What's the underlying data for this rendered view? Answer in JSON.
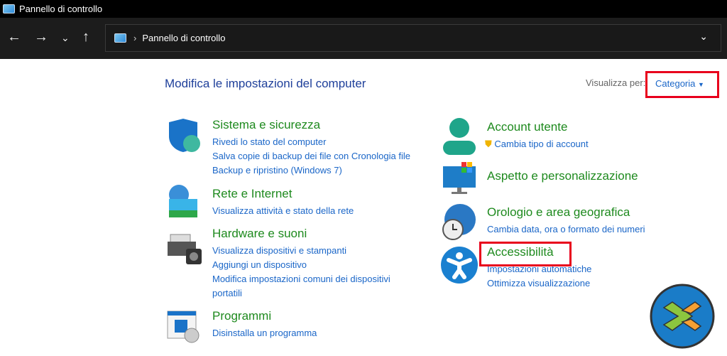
{
  "window": {
    "title": "Pannello di controllo"
  },
  "address": {
    "path": "Pannello di controllo"
  },
  "main": {
    "heading": "Modifica le impostazioni del computer",
    "view_by_label": "Visualizza per:",
    "view_by_value": "Categoria"
  },
  "left": [
    {
      "title": "Sistema e sicurezza",
      "links": [
        "Rivedi lo stato del computer",
        "Salva copie di backup dei file con Cronologia file",
        "Backup e ripristino (Windows 7)"
      ]
    },
    {
      "title": "Rete e Internet",
      "links": [
        "Visualizza attività e stato della rete"
      ]
    },
    {
      "title": "Hardware e suoni",
      "links": [
        "Visualizza dispositivi e stampanti",
        "Aggiungi un dispositivo",
        "Modifica impostazioni comuni dei dispositivi portatili"
      ]
    },
    {
      "title": "Programmi",
      "links": [
        "Disinstalla un programma"
      ]
    }
  ],
  "right": [
    {
      "title": "Account utente",
      "links": [
        "Cambia tipo di account"
      ]
    },
    {
      "title": "Aspetto e personalizzazione",
      "links": []
    },
    {
      "title": "Orologio e area geografica",
      "links": [
        "Cambia data, ora o formato dei numeri"
      ]
    },
    {
      "title": "Accessibilità",
      "links": [
        "Impostazioni automatiche",
        "Ottimizza visualizzazione"
      ]
    }
  ],
  "colors": {
    "heading": "#1e3f9a",
    "category_title": "#1e8a1e",
    "link": "#1a66c8",
    "highlight": "#e8001c"
  }
}
